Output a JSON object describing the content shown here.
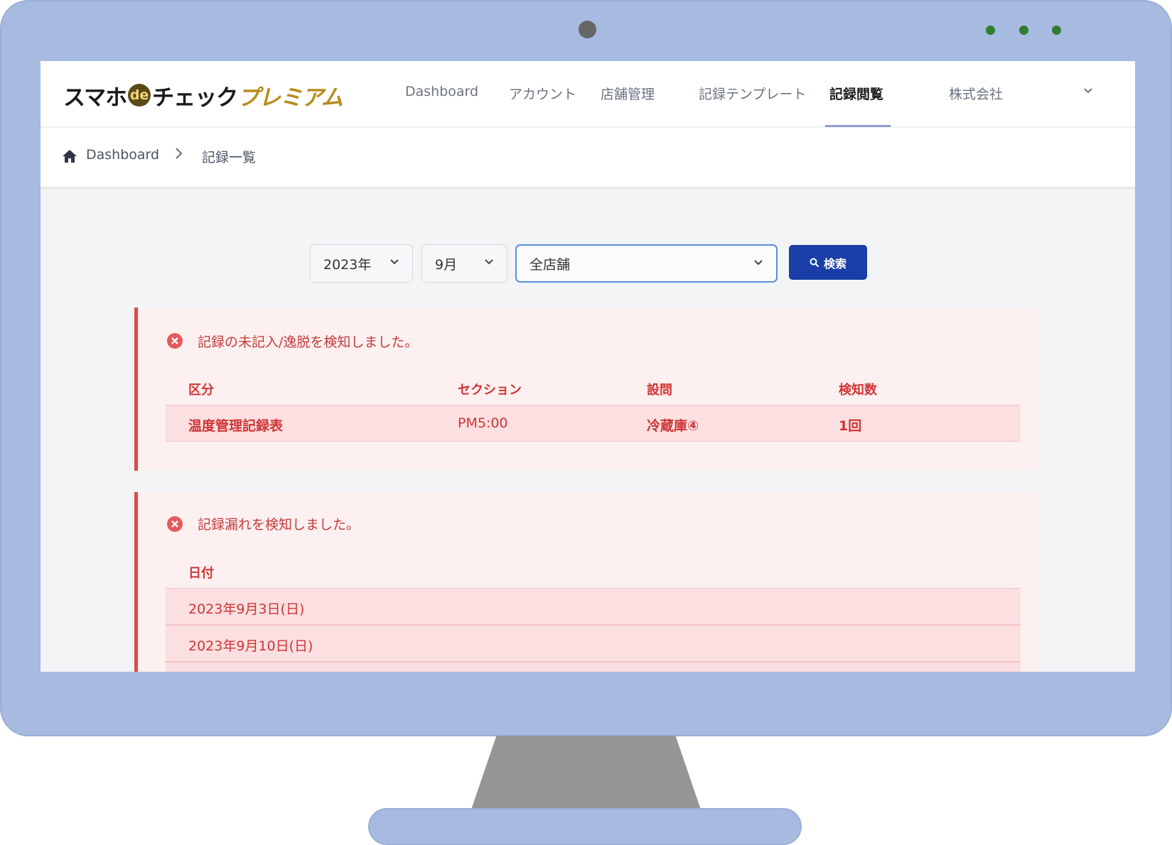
{
  "brand": {
    "part1": "スマホ",
    "part2": "de",
    "part3": "チェック",
    "part4": "プレミアム"
  },
  "nav": {
    "items": [
      "Dashboard",
      "アカウント",
      "店舗管理",
      "記録テンプレート",
      "記録閲覧"
    ],
    "active": "記録閲覧",
    "company": "株式会社"
  },
  "breadcrumb": {
    "home": "Dashboard",
    "current": "記録一覧"
  },
  "filters": {
    "year": "2023年",
    "month": "9月",
    "store": "全店舗",
    "search_label": "検索"
  },
  "alert_missing_entry": {
    "message": "記録の未記入/逸脱を検知しました。",
    "columns": [
      "区分",
      "セクション",
      "設問",
      "検知数"
    ],
    "rows": [
      [
        "温度管理記録表",
        "PM5:00",
        "冷蔵庫④",
        "1回"
      ]
    ]
  },
  "alert_missing_record": {
    "message": "記録漏れを検知しました。",
    "column": "日付",
    "rows": [
      "2023年9月3日(日)",
      "2023年9月10日(日)"
    ]
  },
  "colors": {
    "monitor": "#a7badf",
    "primary_button": "#1a3ea8",
    "alert_red": "#e04848",
    "alert_bg": "#fdf0f0"
  }
}
